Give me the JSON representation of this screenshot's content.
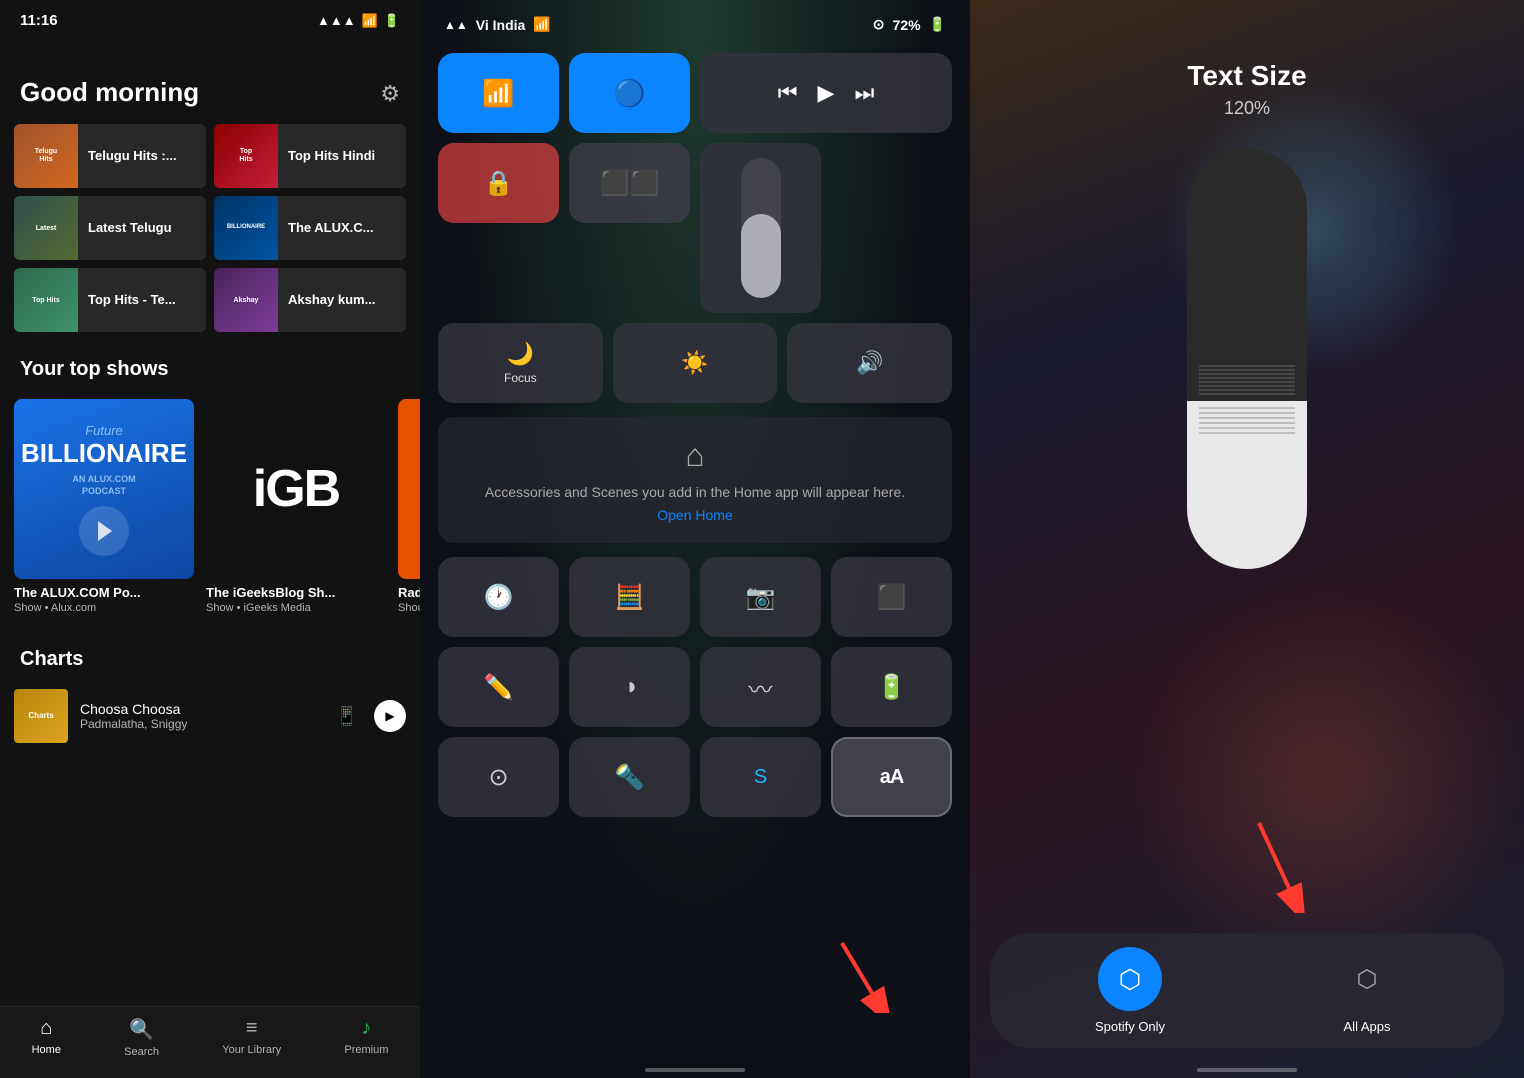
{
  "spotify": {
    "time": "11:16",
    "greeting": "Good morning",
    "playlists": [
      {
        "id": "telugu",
        "name": "Telugu Hits :...",
        "thumb_class": "telugu",
        "thumb_label": "Telugu\nHits"
      },
      {
        "id": "top-hindi",
        "name": "Top Hits Hindi",
        "thumb_class": "top-hindi",
        "thumb_label": "Top Hits\nHindi"
      },
      {
        "id": "latest-telugu",
        "name": "Latest Telugu",
        "thumb_class": "latest-telugu",
        "thumb_label": "Latest\nTelugu"
      },
      {
        "id": "alux",
        "name": "The ALUX.C...",
        "thumb_class": "alux",
        "thumb_label": "BILLIONAIRE"
      },
      {
        "id": "top-hits-te",
        "name": "Top Hits - Te...",
        "thumb_class": "top-hits-te",
        "thumb_label": "Top Hits"
      },
      {
        "id": "akshay",
        "name": "Akshay kum...",
        "thumb_class": "akshay",
        "thumb_label": "Akshay"
      }
    ],
    "shows_title": "Your top shows",
    "shows": [
      {
        "name": "The ALUX.COM Po...",
        "subtitle": "Show • Alux.com",
        "type": "billionaire"
      },
      {
        "name": "The iGeeksBlog Sh...",
        "subtitle": "Show • iGeeks Media",
        "type": "igb"
      },
      {
        "name": "Radi...",
        "subtitle": "Shou... Jaso...",
        "type": "orange"
      }
    ],
    "charts_title": "Charts",
    "chart_song": "Choosa Choosa",
    "chart_artist": "Padmalatha, Sniggy",
    "nav_items": [
      {
        "label": "Home",
        "icon": "⌂",
        "active": true
      },
      {
        "label": "Search",
        "icon": "🔍",
        "active": false
      },
      {
        "label": "Your Library",
        "icon": "≡",
        "active": false
      },
      {
        "label": "Premium",
        "icon": "♪",
        "active": false
      }
    ]
  },
  "control_center": {
    "carrier": "Vi India",
    "battery": "72%",
    "wifi_icon": "wifi",
    "bluetooth_icon": "bluetooth",
    "rewind_icon": "rewind",
    "play_icon": "play",
    "forward_icon": "forward",
    "rotation_lock_icon": "rotation-lock",
    "mirror_icon": "mirror",
    "timer_label": "",
    "focus_label": "Focus",
    "brightness_icon": "brightness",
    "volume_icon": "volume",
    "home_text": "Accessories and Scenes you add in the Home app will appear here.",
    "home_link": "Open Home",
    "apps": [
      "clock",
      "calculator",
      "camera",
      "qr"
    ],
    "apps2": [
      "notes",
      "contrast",
      "waveform",
      "battery",
      "circle",
      "flashlight",
      "shazam",
      "text-size"
    ],
    "text_size_label": "aA"
  },
  "text_size": {
    "title": "Text Size",
    "percent": "120%",
    "spotify_only_label": "Spotify Only",
    "all_apps_label": "All Apps"
  }
}
